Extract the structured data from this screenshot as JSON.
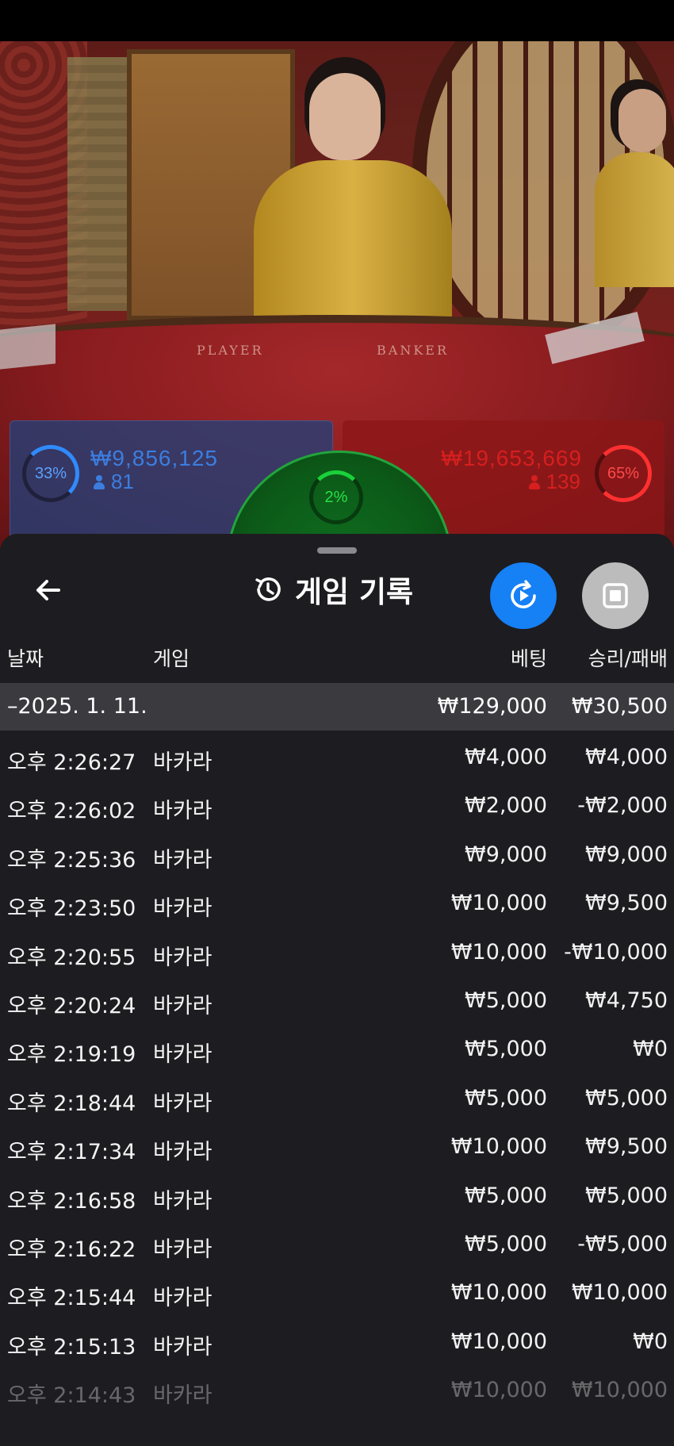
{
  "table_labels": {
    "player": "PLAYER",
    "banker": "BANKER"
  },
  "bet_stats": {
    "player": {
      "percent": "33%",
      "amount": "₩9,856,125",
      "count": "81",
      "color": "#3b7ee0"
    },
    "tie": {
      "percent": "2%",
      "color": "#27e046"
    },
    "banker": {
      "percent": "65%",
      "amount": "₩19,653,669",
      "count": "139",
      "color": "#d71f1f"
    }
  },
  "sheet": {
    "title": "게임 기록",
    "icons": {
      "back": "back-arrow-icon",
      "history": "history-icon",
      "replay": "replay-icon",
      "stop": "stop-icon"
    },
    "replay_color": "#1680f5",
    "columns": {
      "date": "날짜",
      "game": "게임",
      "bet": "베팅",
      "win_loss": "승리/패배"
    },
    "group": {
      "date": "–2025. 1. 11.",
      "bet": "₩129,000",
      "win_loss": "₩30,500"
    },
    "rows": [
      {
        "time": "오후 2:26:27",
        "game": "바카라",
        "bet": "₩4,000",
        "win_loss": "₩4,000"
      },
      {
        "time": "오후 2:26:02",
        "game": "바카라",
        "bet": "₩2,000",
        "win_loss": "-₩2,000"
      },
      {
        "time": "오후 2:25:36",
        "game": "바카라",
        "bet": "₩9,000",
        "win_loss": "₩9,000"
      },
      {
        "time": "오후 2:23:50",
        "game": "바카라",
        "bet": "₩10,000",
        "win_loss": "₩9,500"
      },
      {
        "time": "오후 2:20:55",
        "game": "바카라",
        "bet": "₩10,000",
        "win_loss": "-₩10,000"
      },
      {
        "time": "오후 2:20:24",
        "game": "바카라",
        "bet": "₩5,000",
        "win_loss": "₩4,750"
      },
      {
        "time": "오후 2:19:19",
        "game": "바카라",
        "bet": "₩5,000",
        "win_loss": "₩0"
      },
      {
        "time": "오후 2:18:44",
        "game": "바카라",
        "bet": "₩5,000",
        "win_loss": "₩5,000"
      },
      {
        "time": "오후 2:17:34",
        "game": "바카라",
        "bet": "₩10,000",
        "win_loss": "₩9,500"
      },
      {
        "time": "오후 2:16:58",
        "game": "바카라",
        "bet": "₩5,000",
        "win_loss": "₩5,000"
      },
      {
        "time": "오후 2:16:22",
        "game": "바카라",
        "bet": "₩5,000",
        "win_loss": "-₩5,000"
      },
      {
        "time": "오후 2:15:44",
        "game": "바카라",
        "bet": "₩10,000",
        "win_loss": "₩10,000"
      },
      {
        "time": "오후 2:15:13",
        "game": "바카라",
        "bet": "₩10,000",
        "win_loss": "₩0"
      },
      {
        "time": "오후 2:14:43",
        "game": "바카라",
        "bet": "₩10,000",
        "win_loss": "₩10,000"
      }
    ]
  }
}
